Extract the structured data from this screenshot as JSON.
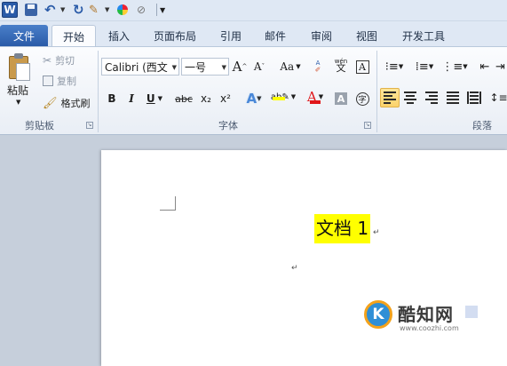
{
  "quick_access": {
    "app_icon": "word-icon",
    "app_letter": "W",
    "items": [
      "save-icon",
      "undo-icon",
      "redo-icon",
      "format-painter-icon",
      "color-icon",
      "pen-icon"
    ]
  },
  "tabs": [
    {
      "label": "文件",
      "state": "file"
    },
    {
      "label": "开始",
      "state": "active"
    },
    {
      "label": "插入"
    },
    {
      "label": "页面布局"
    },
    {
      "label": "引用"
    },
    {
      "label": "邮件"
    },
    {
      "label": "审阅"
    },
    {
      "label": "视图"
    },
    {
      "label": "开发工具"
    }
  ],
  "clipboard": {
    "paste_label": "粘贴",
    "cut_label": "剪切",
    "copy_label": "复制",
    "format_painter_label": "格式刷",
    "group_label": "剪贴板"
  },
  "font": {
    "font_name": "Calibri (西文",
    "font_size": "一号",
    "grow_label": "A",
    "shrink_label": "A",
    "case_label": "Aa",
    "bold": "B",
    "italic": "I",
    "underline": "U",
    "strike": "abc",
    "subscript": "x₂",
    "superscript": "x²",
    "group_label": "字体",
    "phonetic_label": "wén",
    "enclose_char": "字",
    "highlight_color": "#ffff00",
    "font_color": "#e0161a"
  },
  "paragraph": {
    "group_label": "段落"
  },
  "document": {
    "text": "文档 1",
    "highlight_color": "#ffff00",
    "para_mark": "↵"
  },
  "watermark": {
    "name": "酷知网",
    "url": "www.coozhi.com",
    "logo_letter": "K"
  },
  "colors": {
    "file_tab": "#2a5ba8",
    "ribbon_bg": "#fbfcfe",
    "doc_bg": "#c6cfdb",
    "active_button": "#fbd36b"
  }
}
